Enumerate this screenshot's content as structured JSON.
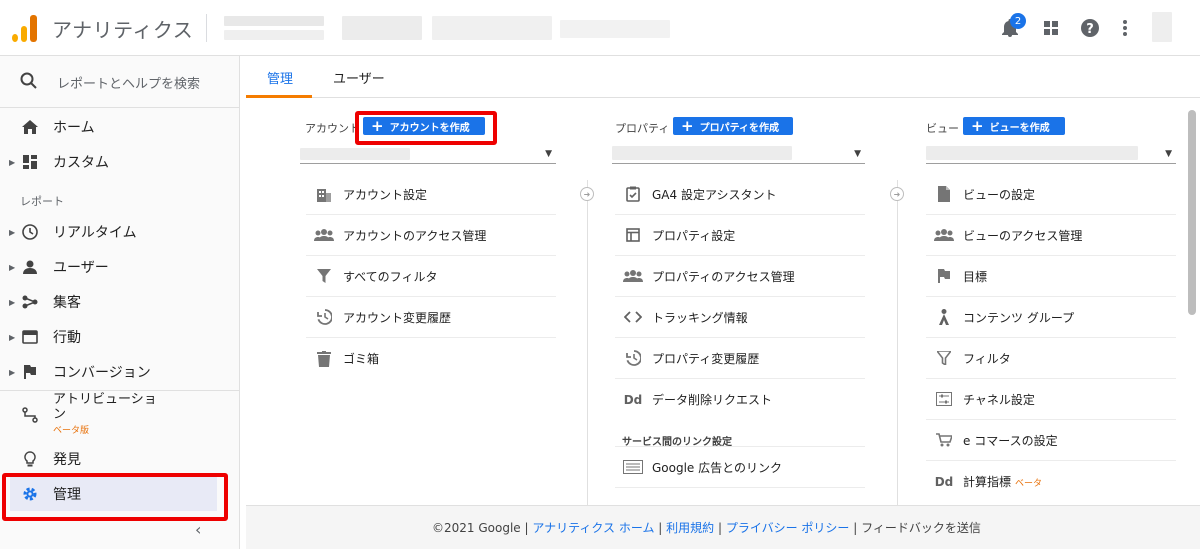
{
  "header": {
    "app_title": "アナリティクス",
    "notification_count": "2",
    "icons": [
      "notifications-icon",
      "apps-icon",
      "help-icon",
      "more-vert-icon"
    ]
  },
  "sidebar": {
    "search_placeholder": "レポートとヘルプを検索",
    "home": "ホーム",
    "custom": "カスタム",
    "reports_section": "レポート",
    "realtime": "リアルタイム",
    "audience": "ユーザー",
    "acquisition": "集客",
    "behavior": "行動",
    "conversions": "コンバージョン",
    "attribution": "アトリビューション",
    "attribution_beta": "ベータ版",
    "discover": "発見",
    "admin": "管理"
  },
  "tabs": {
    "admin": "管理",
    "user": "ユーザー"
  },
  "account_col": {
    "label": "アカウント",
    "create_button": "アカウントを作成",
    "items": [
      "アカウント設定",
      "アカウントのアクセス管理",
      "すべてのフィルタ",
      "アカウント変更履歴",
      "ゴミ箱"
    ]
  },
  "property_col": {
    "label": "プロパティ",
    "create_button": "プロパティを作成",
    "items": [
      "GA4 設定アシスタント",
      "プロパティ設定",
      "プロパティのアクセス管理",
      "トラッキング情報",
      "プロパティ変更履歴",
      "データ削除リクエスト"
    ],
    "link_section": "サービス間のリンク設定",
    "link_items": [
      "Google 広告とのリンク"
    ]
  },
  "view_col": {
    "label": "ビュー",
    "create_button": "ビューを作成",
    "items": [
      "ビューの設定",
      "ビューのアクセス管理",
      "目標",
      "コンテンツ グループ",
      "フィルタ",
      "チャネル設定",
      "e コマースの設定",
      "計算指標"
    ],
    "beta": "ベータ"
  },
  "footer": {
    "copyright": "©2021 Google",
    "analytics_home": "アナリティクス ホーム",
    "terms": "利用規約",
    "privacy": "プライバシー ポリシー",
    "feedback": "フィードバックを送信"
  },
  "colors": {
    "accent_blue": "#1a73e8",
    "tab_orange": "#f57c00",
    "highlight_red": "#e00000"
  }
}
